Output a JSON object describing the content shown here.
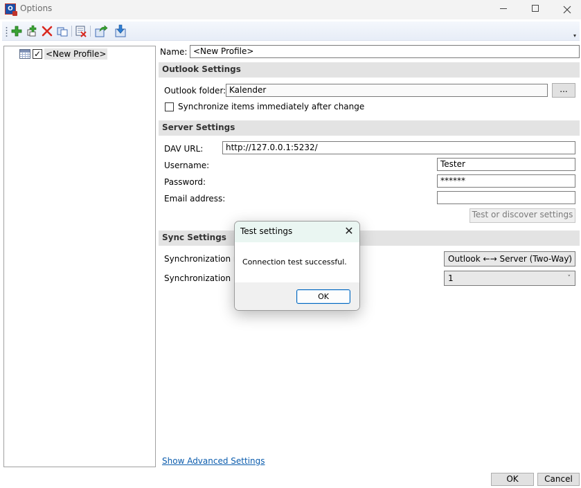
{
  "window": {
    "title": "Options",
    "app_icon_text": "O"
  },
  "toolbar": {
    "buttons": [
      "add-profile-icon",
      "add-multiple-profiles-icon",
      "delete-profile-icon",
      "copy-profile-icon",
      "clear-cache-icon",
      "export-profiles-icon",
      "import-profiles-icon"
    ],
    "overflow_glyph": "▾"
  },
  "tree": {
    "profile_label": "<New Profile>",
    "profile_checked": true,
    "check_glyph": "✓"
  },
  "profile": {
    "name_label": "Name:",
    "name_value": "<New Profile>"
  },
  "outlook_settings": {
    "header": "Outlook Settings",
    "folder_label": "Outlook folder:",
    "folder_value": "Kalender",
    "browse_label": "...",
    "sync_immediately_label": "Synchronize items immediately after change",
    "sync_immediately_checked": false
  },
  "server_settings": {
    "header": "Server Settings",
    "dav_url_label": "DAV URL:",
    "dav_url_value": "http://127.0.0.1:5232/",
    "username_label": "Username:",
    "username_value": "Tester",
    "password_label": "Password:",
    "password_value": "******",
    "email_label": "Email address:",
    "email_value": "",
    "test_button_label": "Test or discover settings"
  },
  "sync_settings": {
    "header": "Sync Settings",
    "mode_label": "Synchronization mo",
    "mode_value": "Outlook ←→ Server (Two-Way)",
    "interval_label": "Synchronization int",
    "interval_value": "1",
    "dropdown_glyph": "˅"
  },
  "footer": {
    "advanced_link": "Show Advanced Settings",
    "ok_label": "OK",
    "cancel_label": "Cancel"
  },
  "dialog": {
    "title": "Test settings",
    "close_glyph": "✕",
    "message": "Connection test successful.",
    "ok_label": "OK"
  },
  "colors": {
    "section_header_bg": "#e3e3e3",
    "link": "#0b5cad",
    "dialog_title_bg": "#eaf6f2",
    "dialog_button_border": "#0067c0"
  }
}
